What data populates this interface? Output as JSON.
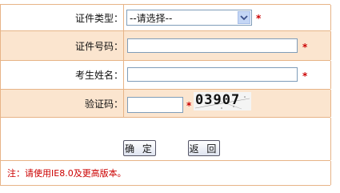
{
  "form": {
    "id_type": {
      "label": "证件类型：",
      "selected": "--请选择--",
      "required_mark": "*"
    },
    "id_number": {
      "label": "证件号码：",
      "value": "",
      "required_mark": "*"
    },
    "name": {
      "label": "考生姓名：",
      "value": "",
      "required_mark": "*"
    },
    "captcha": {
      "label": "验证码：",
      "value": "",
      "required_mark": "*",
      "image_text": "03907"
    }
  },
  "buttons": {
    "confirm": "确 定",
    "back": "返 回"
  },
  "note": "注：请使用IE8.0及更高版本。",
  "colors": {
    "border": "#e7b487",
    "shaded_row": "#fbe5cf",
    "required": "#cc0000"
  }
}
